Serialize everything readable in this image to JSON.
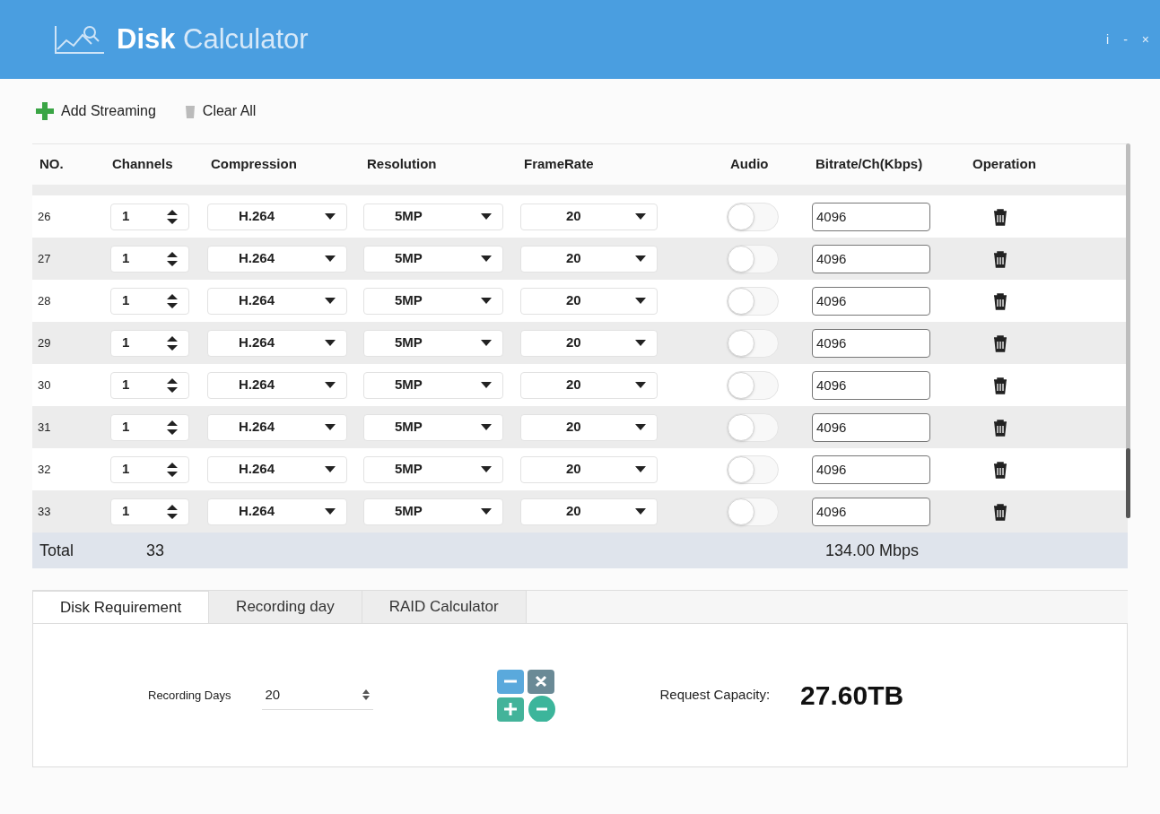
{
  "window": {
    "title_bold": "Disk",
    "title_light": "Calculator",
    "controls": [
      "i",
      "-",
      "×"
    ]
  },
  "toolbar": [
    {
      "kind": "add",
      "label": "Add Streaming"
    },
    {
      "kind": "clear",
      "label": "Clear All"
    }
  ],
  "table": {
    "columns": [
      "NO.",
      "Channels",
      "Compression",
      "Resolution",
      "FrameRate",
      "Audio",
      "Bitrate/Ch(Kbps)",
      "Operation"
    ],
    "rows": [
      {
        "no": "26",
        "channels": "1",
        "compression": "H.264",
        "resolution": "5MP",
        "framerate": "20",
        "audio_on": false,
        "bitrate": "4096"
      },
      {
        "no": "27",
        "channels": "1",
        "compression": "H.264",
        "resolution": "5MP",
        "framerate": "20",
        "audio_on": false,
        "bitrate": "4096"
      },
      {
        "no": "28",
        "channels": "1",
        "compression": "H.264",
        "resolution": "5MP",
        "framerate": "20",
        "audio_on": false,
        "bitrate": "4096"
      },
      {
        "no": "29",
        "channels": "1",
        "compression": "H.264",
        "resolution": "5MP",
        "framerate": "20",
        "audio_on": false,
        "bitrate": "4096"
      },
      {
        "no": "30",
        "channels": "1",
        "compression": "H.264",
        "resolution": "5MP",
        "framerate": "20",
        "audio_on": false,
        "bitrate": "4096"
      },
      {
        "no": "31",
        "channels": "1",
        "compression": "H.264",
        "resolution": "5MP",
        "framerate": "20",
        "audio_on": false,
        "bitrate": "4096"
      },
      {
        "no": "32",
        "channels": "1",
        "compression": "H.264",
        "resolution": "5MP",
        "framerate": "20",
        "audio_on": false,
        "bitrate": "4096"
      },
      {
        "no": "33",
        "channels": "1",
        "compression": "H.264",
        "resolution": "5MP",
        "framerate": "20",
        "audio_on": false,
        "bitrate": "4096"
      }
    ],
    "total": {
      "label": "Total",
      "count": "33",
      "bitrate": "134.00 Mbps"
    }
  },
  "tabs": [
    {
      "label": "Disk Requirement",
      "selected": true
    },
    {
      "label": "Recording day",
      "selected": false
    },
    {
      "label": "RAID Calculator",
      "selected": false
    }
  ],
  "panel": {
    "days_label": "Recording Days",
    "days_value": "20",
    "capacity_label": "Request Capacity:",
    "capacity_value": "27.60TB"
  }
}
